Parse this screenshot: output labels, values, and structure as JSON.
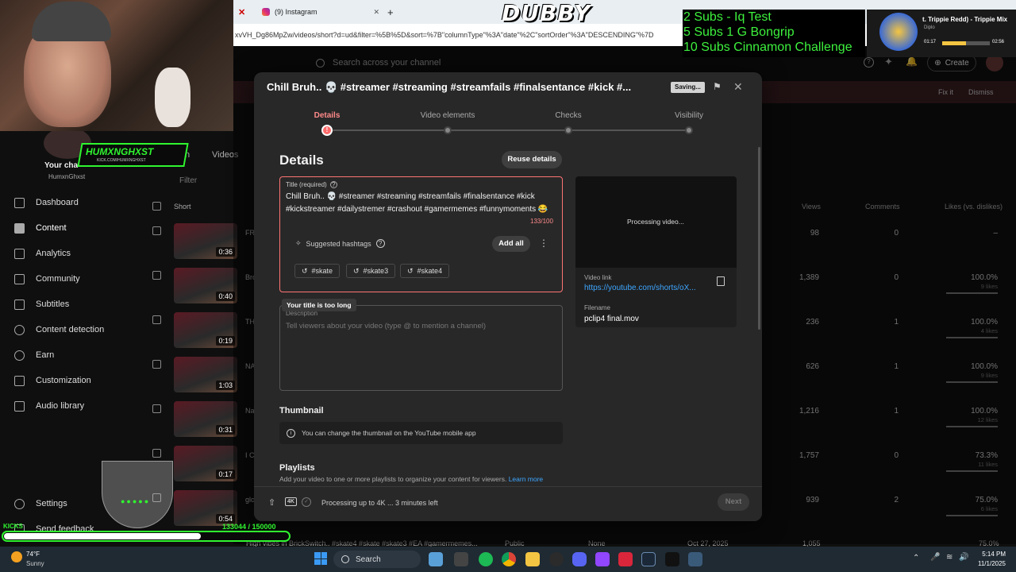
{
  "browser": {
    "tab_instagram": "(9) Instagram",
    "new_tab": "+",
    "address": "xvVH_Dg86MpZw/videos/short?d=ud&filter=%5B%5D&sort=%7B\"columnType\"%3A\"date\"%2C\"sortOrder\"%3A\"DESCENDING\"%7D"
  },
  "overlay": {
    "dubby": "DUBBY",
    "subs_goals": [
      "2 Subs - Iq Test",
      "5 Subs 1 G Bongrip",
      "10 Subs Cinnamon Challenge"
    ],
    "now_playing_title": "t. Trippie Redd) - Trippie Mix",
    "now_playing_artist": "Diplo",
    "time_elapsed": "01:17",
    "time_total": "02:56",
    "streamer_tag": "HUMXNGHXST",
    "streamer_sub": "KICK.COM/HUMXNGHXST",
    "kicks_label": "KICKS",
    "kicks_progress": "133044 / 150000",
    "kicks_fraction": 0.887
  },
  "header": {
    "search_placeholder": "Search across your channel",
    "create_label": "Create",
    "fix_it": "Fix it",
    "dismiss": "Dismiss"
  },
  "sidebar": {
    "channel_label": "Your cha",
    "channel_handle": "HumxnGhxst",
    "items": [
      {
        "label": "Dashboard",
        "icon": "dashboard-icon"
      },
      {
        "label": "Content",
        "icon": "content-icon"
      },
      {
        "label": "Analytics",
        "icon": "analytics-icon"
      },
      {
        "label": "Community",
        "icon": "community-icon"
      },
      {
        "label": "Subtitles",
        "icon": "subtitles-icon"
      },
      {
        "label": "Content detection",
        "icon": "copyright-icon"
      },
      {
        "label": "Earn",
        "icon": "earn-icon"
      },
      {
        "label": "Customization",
        "icon": "customization-icon"
      },
      {
        "label": "Audio library",
        "icon": "audio-library-icon"
      }
    ],
    "settings": "Settings",
    "feedback": "Send feedback"
  },
  "content_list": {
    "tabs": [
      "In",
      "Videos"
    ],
    "filter": "Filter",
    "headers": {
      "short": "Short",
      "views": "Views",
      "comments": "Comments",
      "likes": "Likes (vs. dislikes)"
    },
    "rows": [
      {
        "title": "FR",
        "duration": "0:36",
        "views": "98",
        "comments": "0",
        "likes": "–",
        "likes_sub": ""
      },
      {
        "title": "Bro",
        "duration": "0:40",
        "views": "1,389",
        "comments": "0",
        "likes": "100.0%",
        "likes_sub": "9 likes"
      },
      {
        "title": "TH",
        "duration": "0:19",
        "views": "236",
        "comments": "1",
        "likes": "100.0%",
        "likes_sub": "4 likes"
      },
      {
        "title": "NA",
        "duration": "1:03",
        "views": "626",
        "comments": "1",
        "likes": "100.0%",
        "likes_sub": "9 likes"
      },
      {
        "title": "Na",
        "duration": "0:31",
        "views": "1,216",
        "comments": "1",
        "likes": "100.0%",
        "likes_sub": "12 likes"
      },
      {
        "title": "I C",
        "duration": "0:17",
        "views": "1,757",
        "comments": "0",
        "likes": "73.3%",
        "likes_sub": "11 likes"
      },
      {
        "title": "glo",
        "duration": "0:54",
        "views": "939",
        "comments": "2",
        "likes": "75.0%",
        "likes_sub": "6 likes"
      }
    ],
    "bottom_row": {
      "title": "High vibes in BrickSwitch.. #skate4 #skate #skate3 #EA #gamermemes...",
      "visibility": "Public",
      "restrictions": "None",
      "date": "Oct 27, 2025",
      "views": "1,055",
      "likes": "75.0%"
    }
  },
  "modal": {
    "title": "Chill Bruh.. 💀 #streamer #streaming #streamfails #finalsentance #kick #...",
    "saving": "Saving...",
    "steps": [
      "Details",
      "Video elements",
      "Checks",
      "Visibility"
    ],
    "section_title": "Details",
    "reuse_details": "Reuse details",
    "title_label": "Title (required)",
    "title_value_line1": "Chill Bruh.. 💀 #streamer #streaming #streamfails #finalsentance #kick",
    "title_value_line2": "#kickstreamer #dailystremer #crashout #gamermemes #funnymoments 😂",
    "title_count": "133/100",
    "suggested_hashtags": "Suggested hashtags",
    "add_all": "Add all",
    "hashtags": [
      "#skate",
      "#skate3",
      "#skate4"
    ],
    "error_tooltip": "Your title is too long",
    "description_label": "Description",
    "description_placeholder": "Tell viewers about your video (type @ to mention a channel)",
    "processing_video": "Processing video...",
    "video_link_label": "Video link",
    "video_link": "https://youtube.com/shorts/oX...",
    "filename_label": "Filename",
    "filename": "pclip4 final.mov",
    "thumbnail_title": "Thumbnail",
    "thumbnail_note": "You can change the thumbnail on the YouTube mobile app",
    "playlists_title": "Playlists",
    "playlists_note": "Add your video to one or more playlists to organize your content for viewers.",
    "learn_more": "Learn more",
    "processing_status": "Processing up to 4K ... 3 minutes left",
    "hd_badge": "4K",
    "next": "Next"
  },
  "taskbar": {
    "weather_temp": "74°F",
    "weather_cond": "Sunny",
    "search": "Search",
    "time": "5:14 PM",
    "date": "11/1/2025"
  }
}
